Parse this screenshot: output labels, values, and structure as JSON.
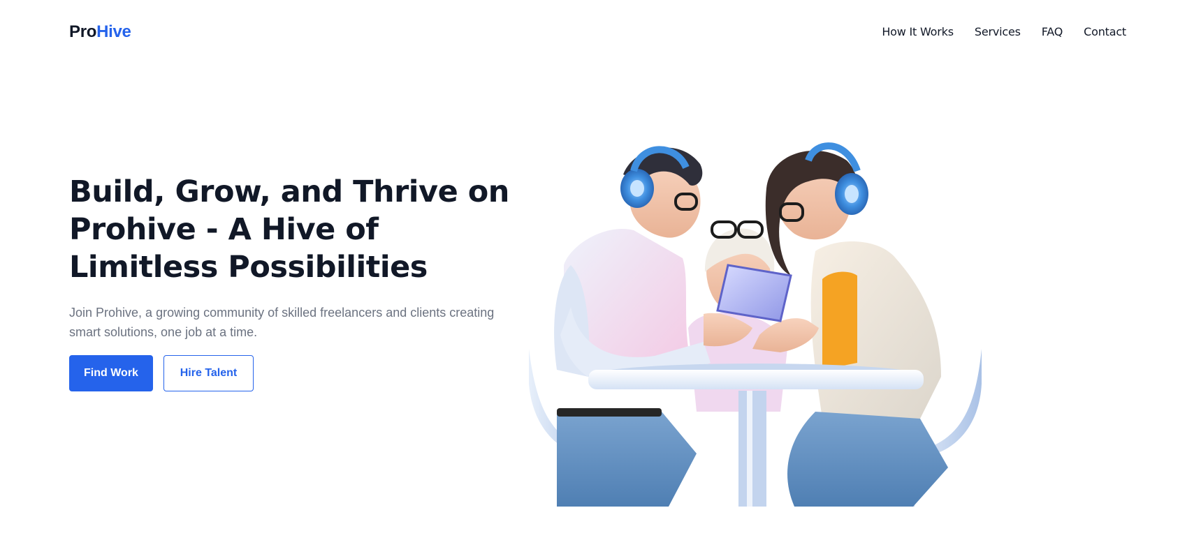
{
  "header": {
    "logo_part1": "Pro",
    "logo_part2": "Hive",
    "nav": [
      "How It Works",
      "Services",
      "FAQ",
      "Contact"
    ]
  },
  "hero": {
    "title": "Build, Grow, and Thrive on Prohive - A Hive of Limitless Possibilities",
    "subtitle": "Join Prohive, a growing community of skilled freelancers and clients creating smart solutions, one job at a time.",
    "primary_button": "Find Work",
    "secondary_button": "Hire Talent"
  },
  "colors": {
    "brand": "#2563eb",
    "text_dark": "#111827",
    "text_muted": "#6b7280",
    "background": "#ffffff"
  },
  "illustration": {
    "icon": "people-at-table-illustration"
  }
}
